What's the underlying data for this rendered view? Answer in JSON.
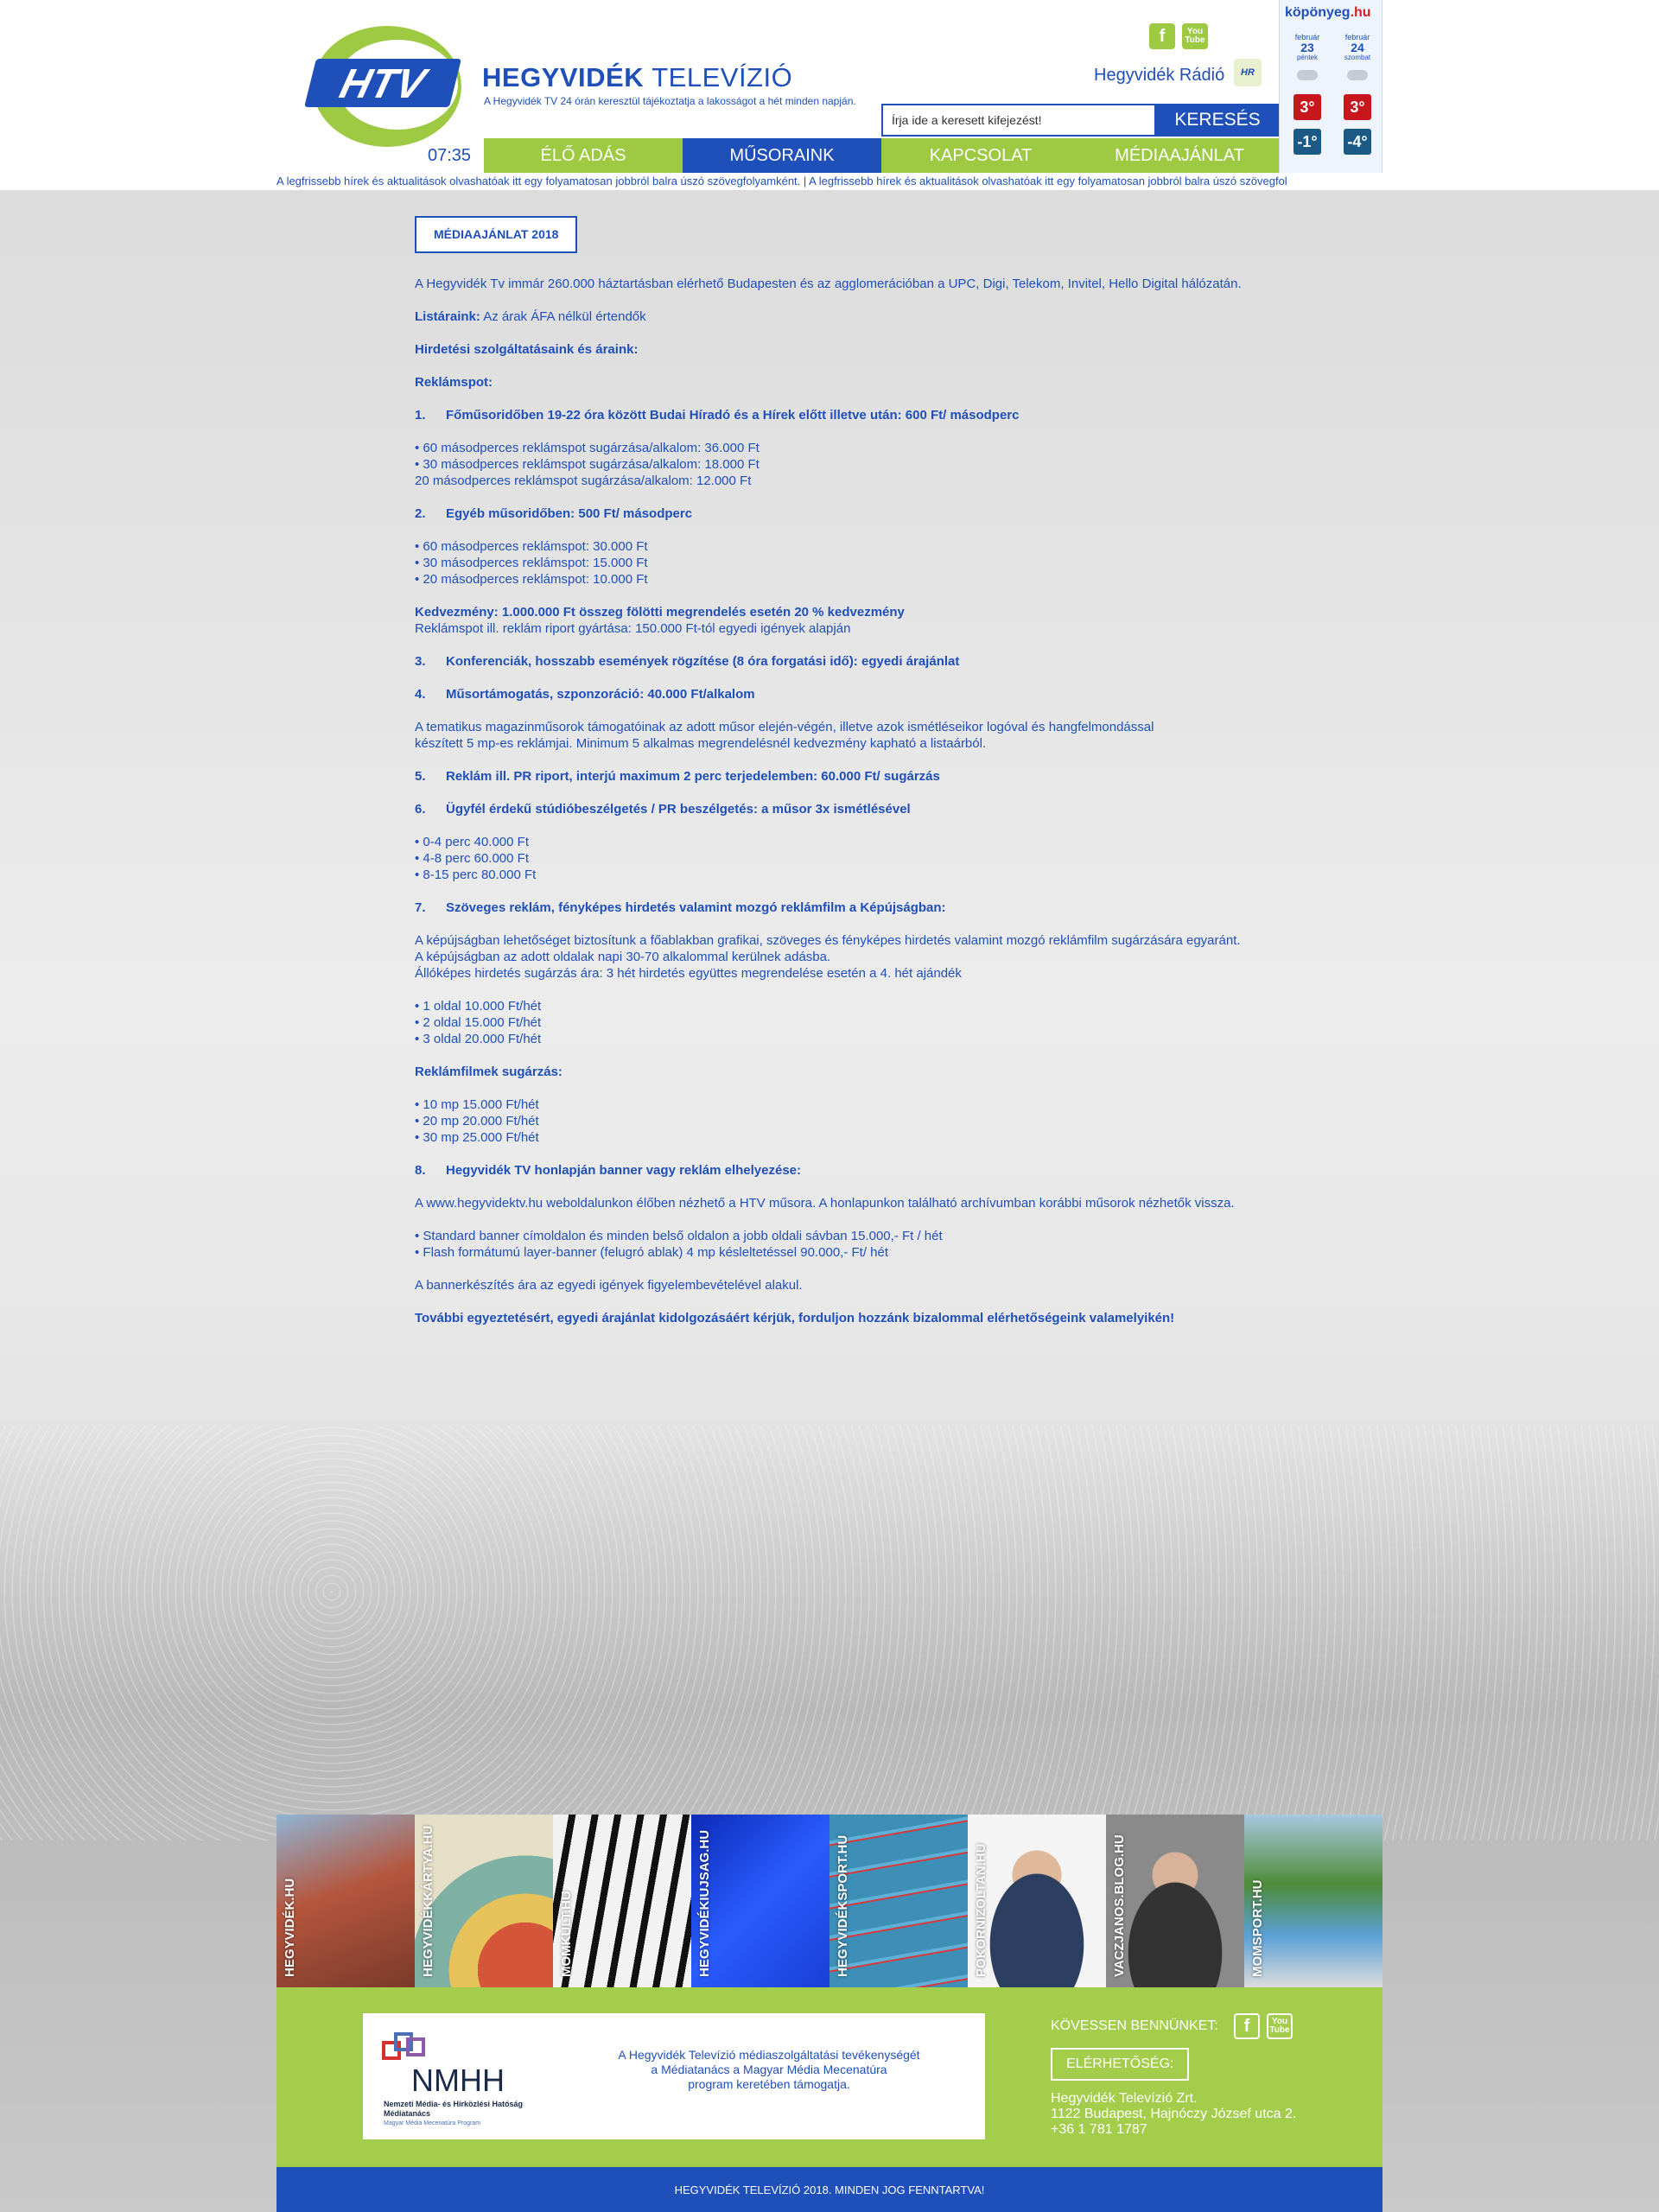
{
  "header": {
    "logo_text": "HTV",
    "site_title_bold": "HEGYVIDÉK",
    "site_title_light": "TELEVÍZIÓ",
    "tagline": "A Hegyvidék TV 24 órán keresztül tájékoztatja a lakosságot a hét minden napján.",
    "clock": "07:35",
    "radio_label": "Hegyvidék Rádió",
    "radio_logo_text": "HR",
    "social_icons": [
      "facebook-icon",
      "youtube-icon"
    ],
    "youtube_text_1": "You",
    "youtube_text_2": "Tube",
    "facebook_text": "f"
  },
  "search": {
    "placeholder": "Írja ide a keresett kifejezést!",
    "button_label": "KERESÉS"
  },
  "nav": {
    "items": [
      {
        "label": "ÉLŐ ADÁS",
        "active": false
      },
      {
        "label": "MŰSORAINK",
        "active": true
      },
      {
        "label": "KAPCSOLAT",
        "active": false
      },
      {
        "label": "MÉDIAAJÁNLAT",
        "active": false
      }
    ]
  },
  "weather": {
    "brand": "köpönyeg",
    "brand_suffix": ".hu",
    "days": [
      {
        "month": "február",
        "day": "23",
        "dow": "péntek",
        "hi": "3°",
        "lo": "-1°"
      },
      {
        "month": "február",
        "day": "24",
        "dow": "szombat",
        "hi": "3°",
        "lo": "-4°"
      }
    ]
  },
  "ticker": {
    "text": "A legfrissebb hírek és aktualitások olvashatóak itt egy folyamatosan jobbról balra úszó szövegfolyamként.   |   A legfrissebb hírek és aktualitások olvashatóak itt egy folyamatosan jobbról balra úszó szövegfol"
  },
  "content": {
    "title": "MÉDIAAJÁNLAT 2018",
    "intro": "A Hegyvidék Tv immár 260.000 háztartásban elérhető Budapesten és az agglomerációban a UPC, Digi, Telekom, Invitel, Hello Digital hálózatán.",
    "lists_label": "Listáraink:",
    "lists_text": " Az árak ÁFA nélkül értendők",
    "services_heading": "Hirdetési szolgáltatásaink és áraink:",
    "spot_heading": "Reklámspot:",
    "item1_num": "1.",
    "item1_title": "Főműsoridőben 19-22 óra között Budai Híradó és a Hírek előtt illetve után: 600 Ft/ másodperc",
    "item1_lines": [
      "• 60 másodperces reklámspot sugárzása/alkalom: 36.000 Ft",
      "• 30 másodperces reklámspot sugárzása/alkalom: 18.000 Ft",
      "20 másodperces reklámspot sugárzása/alkalom: 12.000 Ft"
    ],
    "item2_num": "2.",
    "item2_title": "Egyéb műsoridőben: 500 Ft/ másodperc",
    "item2_lines": [
      "• 60 másodperces reklámspot: 30.000 Ft",
      "• 30 másodperces reklámspot: 15.000 Ft",
      "• 20 másodperces reklámspot: 10.000 Ft"
    ],
    "discount_bold": "Kedvezmény: 1.000.000 Ft összeg fölötti megrendelés esetén 20 % kedvezmény",
    "discount_line": "Reklámspot ill. reklám riport gyártása: 150.000 Ft-tól egyedi igények alapján",
    "item3_num": "3.",
    "item3_title": "Konferenciák, hosszabb események rögzítése (8 óra forgatási idő): egyedi árajánlat",
    "item4_num": "4.",
    "item4_title": "Műsortámogatás, szponzoráció: 40.000 Ft/alkalom",
    "item4_lines": [
      "A tematikus magazinműsorok támogatóinak az adott műsor elején-végén, illetve azok ismétléseikor logóval és hangfelmondással",
      "készített 5 mp-es reklámjai. Minimum 5 alkalmas megrendelésnél kedvezmény kapható a listaárból."
    ],
    "item5_num": "5.",
    "item5_title": "Reklám ill. PR riport, interjú maximum 2 perc terjedelemben: 60.000 Ft/ sugárzás",
    "item6_num": "6.",
    "item6_title": "Ügyfél érdekű stúdióbeszélgetés / PR beszélgetés: a műsor 3x ismétlésével",
    "item6_lines": [
      "• 0-4 perc 40.000 Ft",
      "• 4-8 perc 60.000 Ft",
      "• 8-15 perc 80.000 Ft"
    ],
    "item7_num": "7.",
    "item7_title": "Szöveges reklám, fényképes hirdetés valamint mozgó reklámfilm a Képújságban:",
    "item7_lines": [
      "A képújságban lehetőséget biztosítunk a főablakban grafikai, szöveges és fényképes hirdetés valamint mozgó reklámfilm sugárzására egyaránt.",
      "A képújságban az adott oldalak napi 30-70 alkalommal kerülnek adásba.",
      "Állóképes hirdetés sugárzás ára: 3 hét hirdetés együttes megrendelése esetén a 4. hét ajándék"
    ],
    "item7_prices": [
      "• 1 oldal 10.000 Ft/hét",
      "• 2 oldal 15.000 Ft/hét",
      "• 3 oldal 20.000 Ft/hét"
    ],
    "films_heading": "Reklámfilmek sugárzás:",
    "films_lines": [
      "• 10 mp 15.000 Ft/hét",
      "• 20 mp 20.000 Ft/hét",
      "• 30 mp 25.000 Ft/hét"
    ],
    "item8_num": "8.",
    "item8_title": "Hegyvidék TV honlapján banner vagy reklám elhelyezése:",
    "item8_intro": "A www.hegyvidektv.hu weboldalunkon élőben nézhető a HTV műsora. A honlapunkon található archívumban korábbi műsorok nézhetők vissza.",
    "item8_lines": [
      "• Standard banner címoldalon és minden belső oldalon a jobb oldali sávban 15.000,- Ft / hét",
      "• Flash formátumú layer-banner (felugró ablak) 4 mp késleltetéssel 90.000,- Ft/ hét"
    ],
    "item8_note": "A bannerkészítés ára az egyedi igények figyelembevételével alakul.",
    "closing": "További egyeztetésért, egyedi árajánlat kidolgozásáért kérjük, forduljon hozzánk bizalommal elérhetőségeink valamelyikén!"
  },
  "tiles": [
    {
      "label": "HEGYVIDÉK.HU",
      "color1": "#b5563e",
      "color2": "#6f8fa8"
    },
    {
      "label": "HEGYVIDÉKKÁRTYA.HU",
      "color1": "#d4553a",
      "color2": "#7fb0a4"
    },
    {
      "label": "MOMKULT.HU",
      "color1": "#111111",
      "color2": "#eeeeee"
    },
    {
      "label": "HEGYVIDÉKIUJSAG.HU",
      "color1": "#1a3fd6",
      "color2": "#3c78ff"
    },
    {
      "label": "HEGYVIDÉKSPORT.HU",
      "color1": "#3d8fb8",
      "color2": "#d63a3a"
    },
    {
      "label": "POKORNIZOLTAN.HU",
      "color1": "#ffffff",
      "color2": "#2c3f60"
    },
    {
      "label": "VACZJANOS.BLOG.HU",
      "color1": "#3a3a3a",
      "color2": "#8a8a8a"
    },
    {
      "label": "MOMSPORT.HU",
      "color1": "#4f8c3a",
      "color2": "#5aa0d6"
    }
  ],
  "footer": {
    "nmhh_logo_text": "NMHH",
    "nmhh_caption_1": "Nemzeti Média- és Hírközlési Hatóság",
    "nmhh_caption_2": "Médiatanács",
    "nmhh_caption_3": "Magyar Média Mecenatúra Program",
    "support_text_1": "A Hegyvidék Televízió médiaszolgáltatási tevékenységét",
    "support_text_2": "a Médiatanács a Magyar Média Mecenatúra",
    "support_text_3": "program keretében támogatja.",
    "follow_label": "KÖVESSEN BENNÜNKET:",
    "contact_button": "ELÉRHETŐSÉG:",
    "address_1": "Hegyvidék Televízió Zrt.",
    "address_2": "1122 Budapest, Hajnóczy József utca 2.",
    "address_3": "+36 1 781 1787",
    "copyright": "HEGYVIDÉK TELEVÍZIÓ 2018. MINDEN JOG FENNTARTVA!"
  },
  "colors": {
    "brand_blue": "#1f4fb8",
    "brand_green": "#9dc943",
    "footer_green": "#a3cd4b",
    "weather_red": "#c8161d",
    "weather_blue": "#1b5a87"
  }
}
